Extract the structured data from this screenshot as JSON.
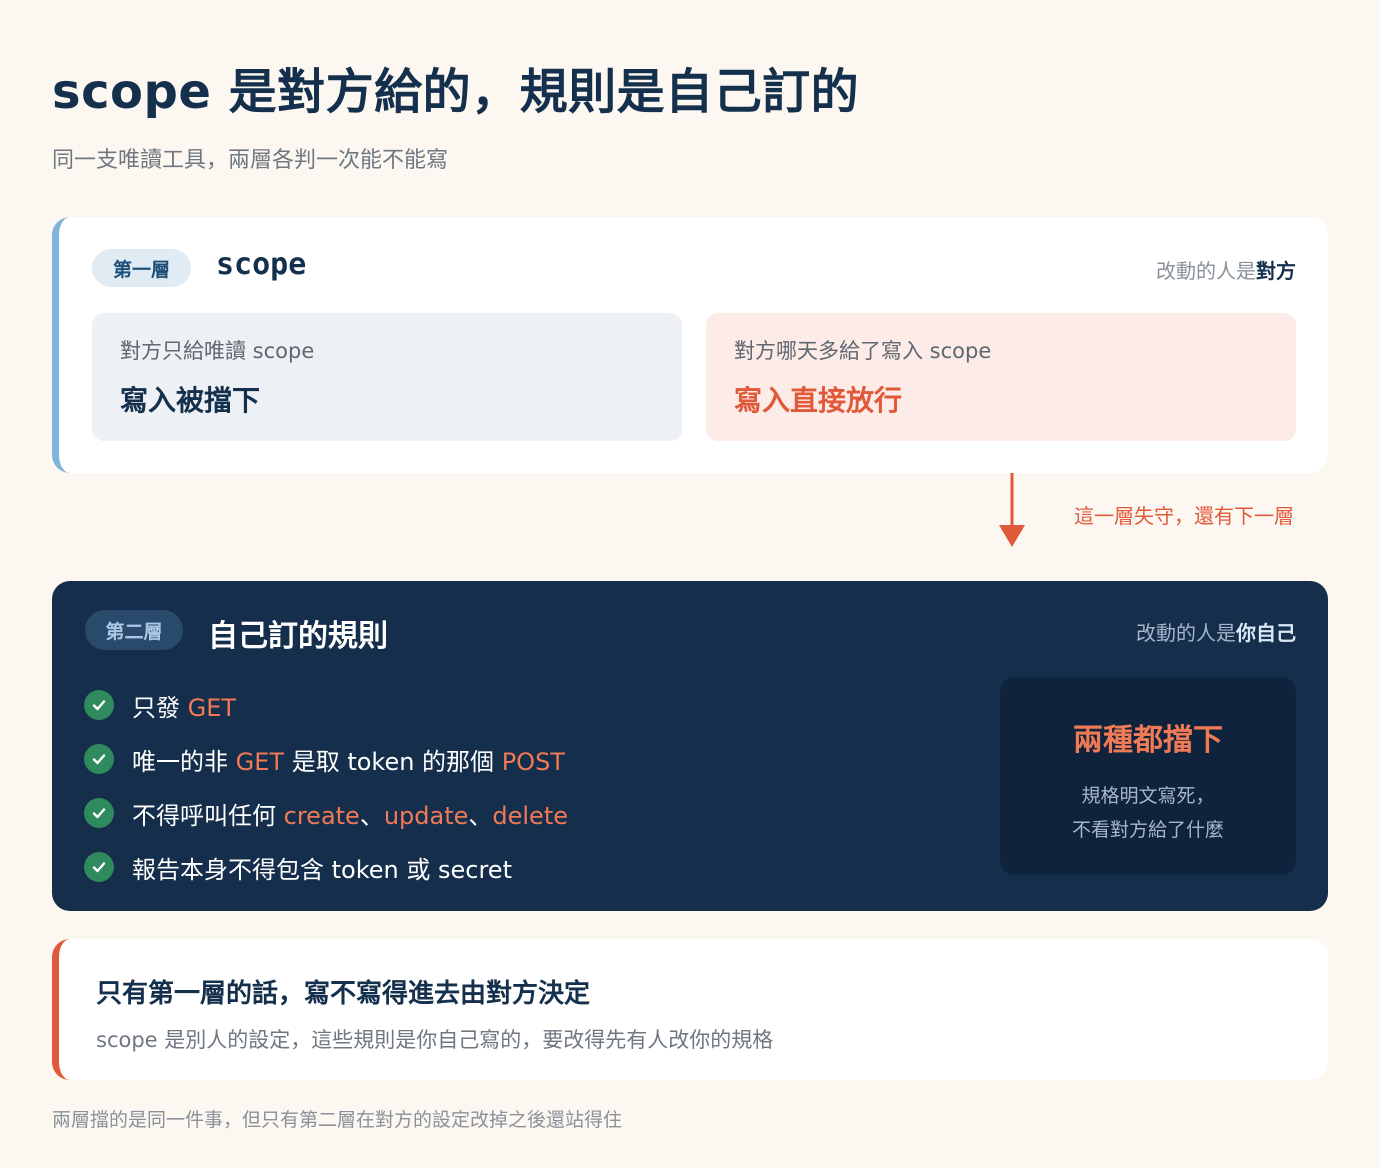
{
  "header": {
    "title": "scope 是對方給的，規則是自己訂的",
    "subtitle": "同一支唯讀工具，兩層各判一次能不能寫"
  },
  "layer1": {
    "badge": "第一層",
    "name": "scope",
    "changer_prefix": "改動的人是",
    "changer_who": "對方",
    "left": {
      "condition": "對方只給唯讀 scope",
      "result": "寫入被擋下"
    },
    "right": {
      "condition": "對方哪天多給了寫入 scope",
      "result": "寫入直接放行"
    }
  },
  "connector": {
    "label": "這一層失守，還有下一層"
  },
  "layer2": {
    "badge": "第二層",
    "name": "自己訂的規則",
    "changer_prefix": "改動的人是",
    "changer_who": "你自己",
    "rules": [
      {
        "parts": [
          {
            "t": "只發 "
          },
          {
            "t": "GET",
            "hl": true
          }
        ]
      },
      {
        "parts": [
          {
            "t": "唯一的非 "
          },
          {
            "t": "GET",
            "hl": true
          },
          {
            "t": " 是取 token 的那個 "
          },
          {
            "t": "POST",
            "hl": true
          }
        ]
      },
      {
        "parts": [
          {
            "t": "不得呼叫任何 "
          },
          {
            "t": "create",
            "hl": true
          },
          {
            "t": "、"
          },
          {
            "t": "update",
            "hl": true
          },
          {
            "t": "、"
          },
          {
            "t": "delete",
            "hl": true
          }
        ]
      },
      {
        "parts": [
          {
            "t": "報告本身不得包含 token 或 secret"
          }
        ]
      }
    ],
    "verdict": {
      "title": "兩種都擋下",
      "line1": "規格明文寫死，",
      "line2": "不看對方給了什麼"
    }
  },
  "conclusion": {
    "heading": "只有第一層的話，寫不寫得進去由對方決定",
    "body": "scope 是別人的設定，這些規則是你自己寫的，要改得先有人改你的規格"
  },
  "footnote": "兩層擋的是同一件事，但只有第二層在對方的設定改掉之後還站得住",
  "colors": {
    "background": "#fcf7f0",
    "navy": "#14304d",
    "accent_red": "#e05a3a",
    "highlight_orange": "#f07a55",
    "layer1_bar": "#7eb3dc",
    "check_green": "#2f8a5e"
  }
}
